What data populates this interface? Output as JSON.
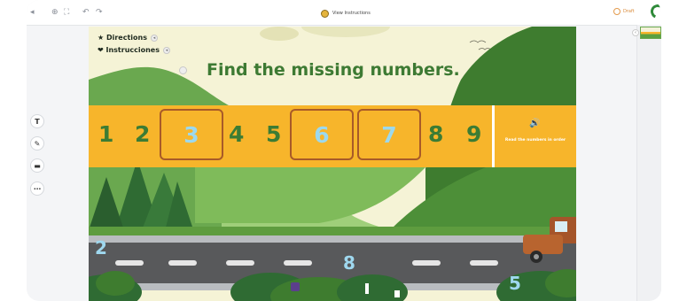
{
  "toolbar": {
    "icons": [
      "back-arrow-icon",
      "zoom-icon",
      "fullscreen-icon",
      "undo-icon",
      "redo-icon"
    ],
    "document_title": "View Instructions",
    "status": "Draft"
  },
  "side_tools": [
    "text-tool-icon",
    "pen-tool-icon",
    "eraser-tool-icon",
    "more-options-icon"
  ],
  "slide": {
    "directions_label": "★ Directions",
    "instructions_label": "❤ Instrucciones",
    "heading": "Find the missing numbers.",
    "sequence": [
      {
        "value": "1",
        "type": "given"
      },
      {
        "value": "2",
        "type": "given"
      },
      {
        "value": "3",
        "type": "answer"
      },
      {
        "value": "4",
        "type": "given"
      },
      {
        "value": "5",
        "type": "given"
      },
      {
        "value": "6",
        "type": "answer"
      },
      {
        "value": "7",
        "type": "answer"
      },
      {
        "value": "8",
        "type": "given"
      },
      {
        "value": "9",
        "type": "given"
      }
    ],
    "audio_caption": "Read the numbers in order",
    "road_numbers": [
      "2",
      "8",
      "5"
    ]
  },
  "colors": {
    "band": "#f7b52b",
    "number_green": "#3c7c34",
    "answer_blue": "#9cd9ee",
    "box_border": "#a85a28",
    "heading_green": "#3d7a33"
  }
}
